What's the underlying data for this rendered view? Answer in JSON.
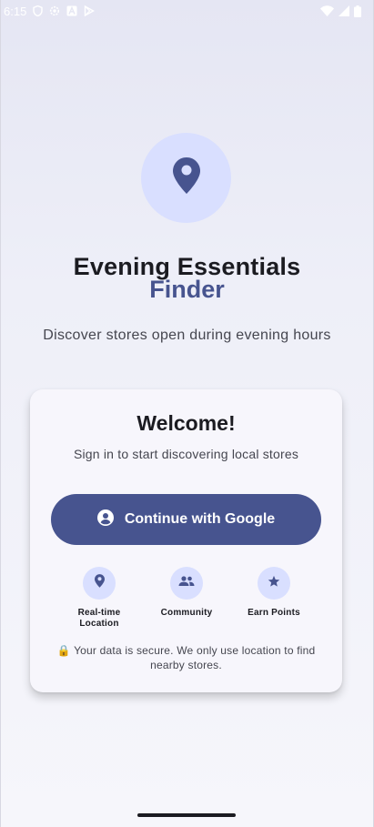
{
  "status_bar": {
    "time": "6:15",
    "notification_icons": [
      "shield-icon",
      "settings-icon",
      "font-icon",
      "play-store-icon"
    ],
    "system_icons": [
      "wifi-icon",
      "signal-icon",
      "battery-icon"
    ]
  },
  "hero": {
    "icon": "location-pin-icon",
    "title": "Evening Essentials",
    "title_accent": "Finder",
    "tagline": "Discover stores open during evening hours"
  },
  "card": {
    "title": "Welcome!",
    "subtitle": "Sign in to start discovering local stores",
    "google_button_label": "Continue with Google",
    "features": [
      {
        "icon": "location-pin-icon",
        "label": "Real-time Location"
      },
      {
        "icon": "people-icon",
        "label": "Community"
      },
      {
        "icon": "star-icon",
        "label": "Earn Points"
      }
    ],
    "privacy_note": "🔒 Your data is secure. We only use location to find nearby stores."
  },
  "colors": {
    "primary": "#47548f",
    "icon_container": "#d9dfff",
    "background": "#eeeff8",
    "card": "#f7f6fc"
  }
}
